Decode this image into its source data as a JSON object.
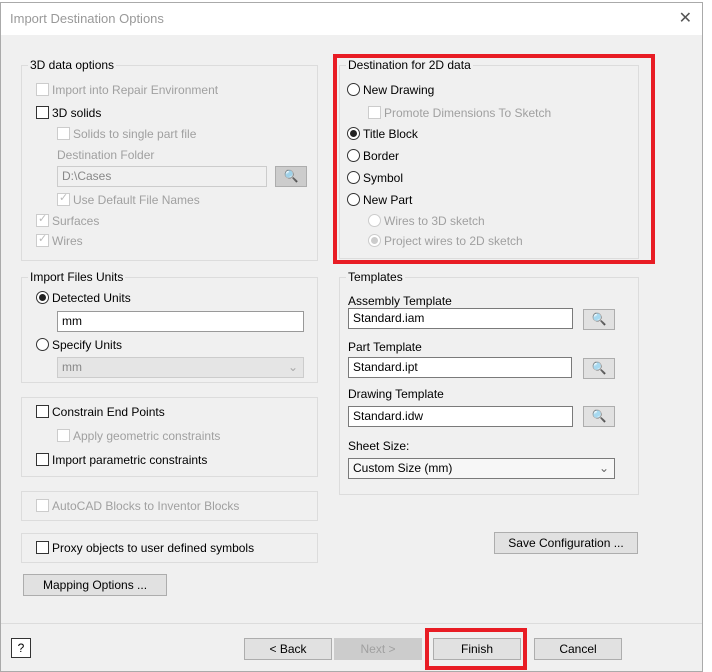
{
  "window": {
    "title": "Import Destination Options"
  },
  "data3d": {
    "legend": "3D data options",
    "repair": "Import into Repair Environment",
    "solids": "3D solids",
    "single_part": "Solids to single part file",
    "dest_folder_label": "Destination Folder",
    "dest_folder_value": "D:\\Cases",
    "default_names": "Use Default File Names",
    "surfaces": "Surfaces",
    "wires": "Wires"
  },
  "units": {
    "legend": "Import Files Units",
    "detected": "Detected Units",
    "detected_value": "mm",
    "specify": "Specify Units",
    "specify_value": "mm"
  },
  "constraints": {
    "end_points": "Constrain End Points",
    "geometric": "Apply geometric constraints",
    "parametric": "Import parametric constraints"
  },
  "autocad_blocks": "AutoCAD Blocks to Inventor Blocks",
  "proxy": "Proxy objects to user defined symbols",
  "mapping_button": "Mapping Options ...",
  "dest2d": {
    "legend": "Destination for 2D data",
    "new_drawing": "New Drawing",
    "promote": "Promote Dimensions To Sketch",
    "title_block": "Title Block",
    "border": "Border",
    "symbol": "Symbol",
    "new_part": "New Part",
    "wires_3d": "Wires to 3D sketch",
    "wires_2d": "Project wires to 2D sketch"
  },
  "templates": {
    "legend": "Templates",
    "assembly_label": "Assembly Template",
    "assembly_value": "Standard.iam",
    "part_label": "Part Template",
    "part_value": "Standard.ipt",
    "drawing_label": "Drawing Template",
    "drawing_value": "Standard.idw",
    "sheet_label": "Sheet Size:",
    "sheet_value": "Custom Size (mm)"
  },
  "save_config": "Save Configuration ...",
  "footer": {
    "help": "?",
    "back": "< Back",
    "next": "Next >",
    "finish": "Finish",
    "cancel": "Cancel"
  },
  "colors": {
    "highlight": "#e81c24"
  }
}
